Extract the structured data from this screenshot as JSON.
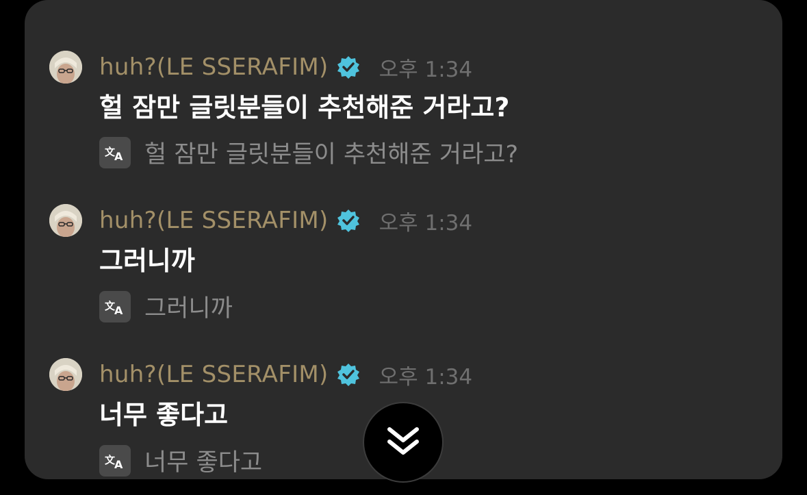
{
  "messages": [
    {
      "author": "huh?(LE SSERAFIM)",
      "time": "오후 1:34",
      "text": "헐 잠만 글릿분들이 추천해준 거라고?",
      "translation": "헐 잠만 글릿분들이 추천해준 거라고?"
    },
    {
      "author": "huh?(LE SSERAFIM)",
      "time": "오후 1:34",
      "text": "그러니까",
      "translation": "그러니까"
    },
    {
      "author": "huh?(LE SSERAFIM)",
      "time": "오후 1:34",
      "text": "너무 좋다고",
      "translation": "너무 좋다고"
    }
  ],
  "icons": {
    "verified": "verified-badge-icon",
    "translate": "translate-icon",
    "scroll": "double-chevron-down-icon"
  },
  "colors": {
    "panel": "#2b2b2b",
    "username": "#a39068",
    "verified": "#4fc3dd",
    "time": "#6f6f6f",
    "translation": "#8c8c8c"
  }
}
